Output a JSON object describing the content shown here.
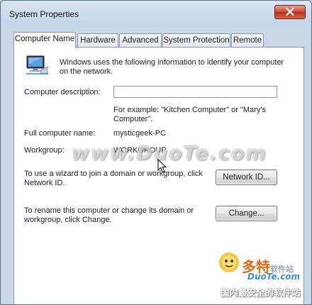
{
  "window": {
    "title": "System Properties"
  },
  "tabs": [
    {
      "label": "Computer Name",
      "active": true
    },
    {
      "label": "Hardware",
      "active": false
    },
    {
      "label": "Advanced",
      "active": false
    },
    {
      "label": "System Protection",
      "active": false
    },
    {
      "label": "Remote",
      "active": false
    }
  ],
  "panel": {
    "intro": "Windows uses the following information to identify your computer on the network.",
    "description_label": "Computer description:",
    "description_value": "",
    "example_text": "For example: \"Kitchen Computer\" or \"Mary's Computer\".",
    "full_name_label": "Full computer name:",
    "full_name_value": "mysticgeek-PC",
    "workgroup_label": "Workgroup:",
    "workgroup_value": "WORKGROUP",
    "network_id_text": "To use a wizard to join a domain or workgroup, click Network ID.",
    "network_id_button": "Network ID...",
    "change_text": "To rename this computer or change its domain or workgroup, click Change.",
    "change_button": "Change..."
  },
  "watermark": {
    "text": "www.DuoTe.com"
  },
  "logo": {
    "line1": "多特",
    "line1_small": "软件站",
    "line2": "DuoTe.com",
    "line3": "国内最安全的软件站"
  },
  "icons": {
    "computer": "network-computer-icon",
    "close": "close-icon",
    "cursor": "mouse-pointer-icon"
  },
  "colors": {
    "accent": "#3d8fd0",
    "close_button": "#c9442b",
    "logo_orange": "#e06a1a"
  }
}
